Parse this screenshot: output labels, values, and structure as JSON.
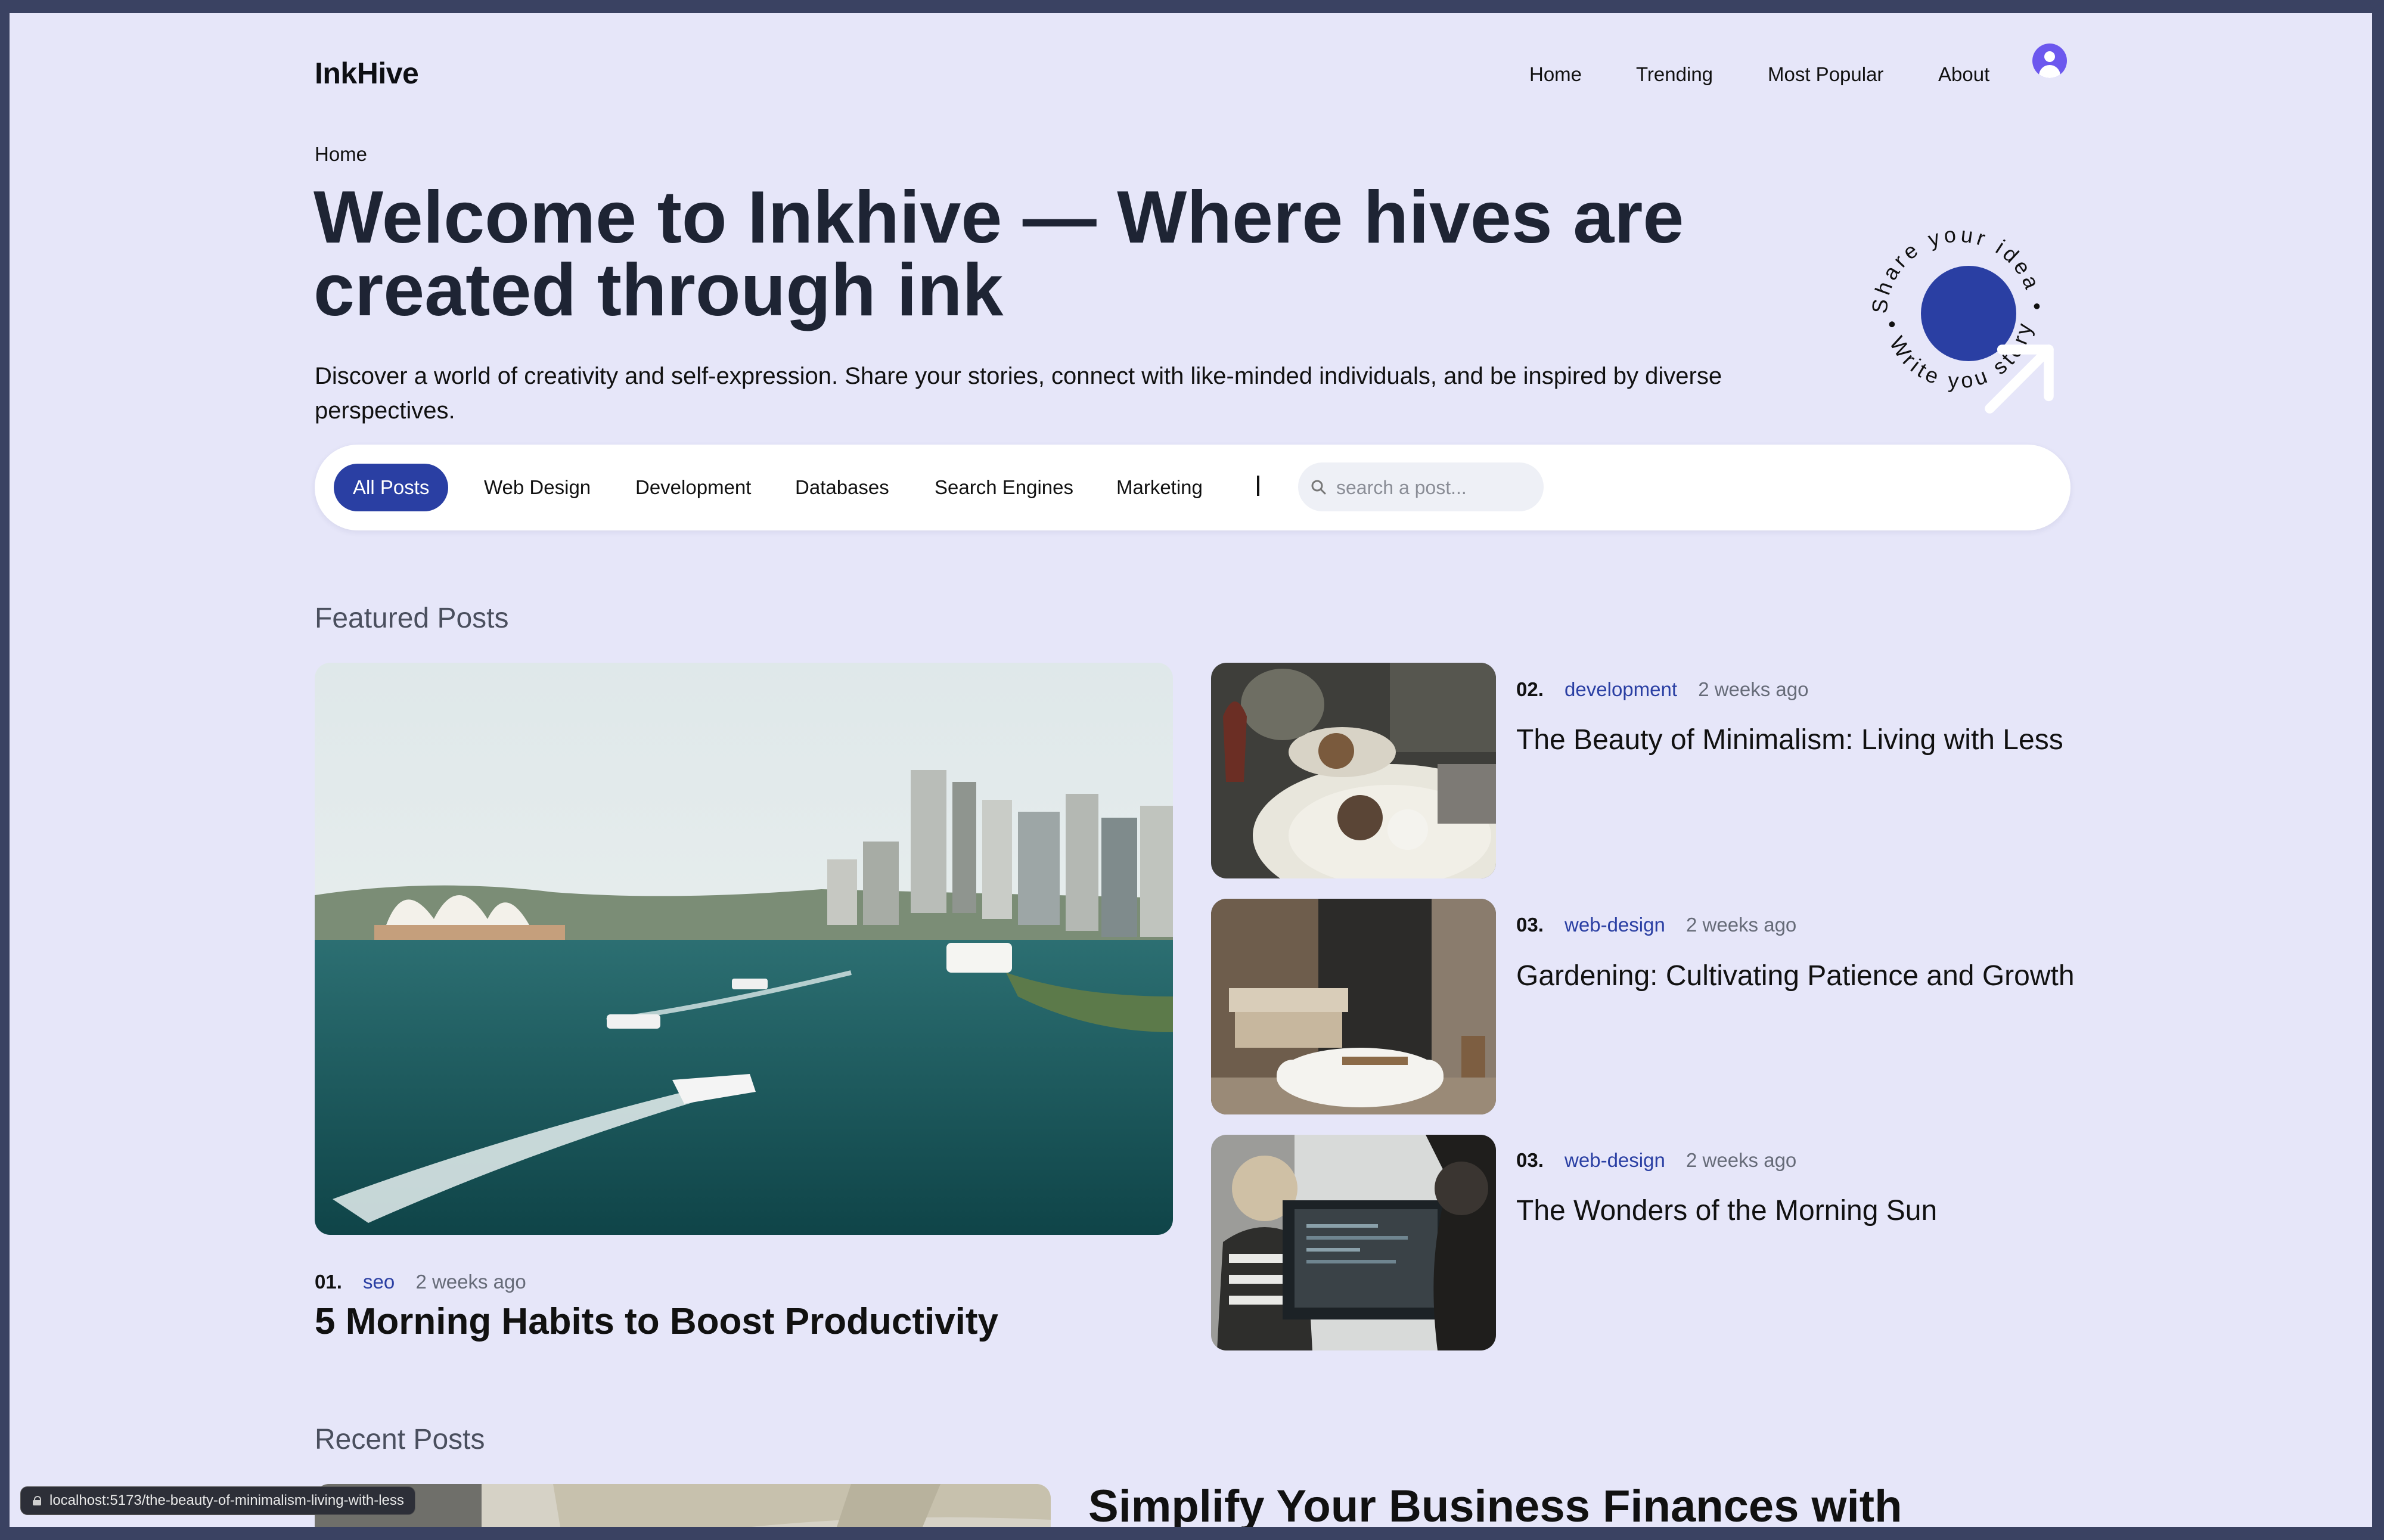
{
  "brand": {
    "logo": "InkHive"
  },
  "nav": {
    "home": "Home",
    "trending": "Trending",
    "most_popular": "Most Popular",
    "about": "About"
  },
  "breadcrumb": "Home",
  "hero": {
    "title": "Welcome to Inkhive — Where hives are created through ink",
    "description": "Discover a world of creativity and self-expression. Share your stories, connect with like-minded individuals, and be inspired by diverse perspectives."
  },
  "badge": {
    "top_text": "Share your idea •",
    "bottom_text": "• Write you story",
    "icon": "arrow-up-right-icon"
  },
  "filters": {
    "chips": [
      "All Posts",
      "Web Design",
      "Development",
      "Databases",
      "Search Engines",
      "Marketing"
    ],
    "active": "All Posts",
    "divider": "|",
    "search_placeholder": "search a post..."
  },
  "featured": {
    "heading": "Featured Posts",
    "main": {
      "num": "01.",
      "category": "seo",
      "time": "2 weeks ago",
      "title": "5 Morning Habits to Boost Productivity"
    },
    "side": [
      {
        "num": "02.",
        "category": "development",
        "time": "2 weeks ago",
        "title": "The Beauty of Minimalism: Living with Less"
      },
      {
        "num": "03.",
        "category": "web-design",
        "time": "2 weeks ago",
        "title": "Gardening: Cultivating Patience and Growth"
      },
      {
        "num": "03.",
        "category": "web-design",
        "time": "2 weeks ago",
        "title": "The Wonders of the Morning Sun"
      }
    ]
  },
  "recent": {
    "heading": "Recent Posts",
    "first_title": "Simplify Your Business Finances with"
  },
  "status_bar": {
    "url": "localhost:5173/the-beauty-of-minimalism-living-with-less"
  },
  "colors": {
    "accent": "#2a3fa3",
    "page_bg": "#e6e6f9",
    "avatar": "#6c58ee",
    "frame": "#3a4262"
  }
}
